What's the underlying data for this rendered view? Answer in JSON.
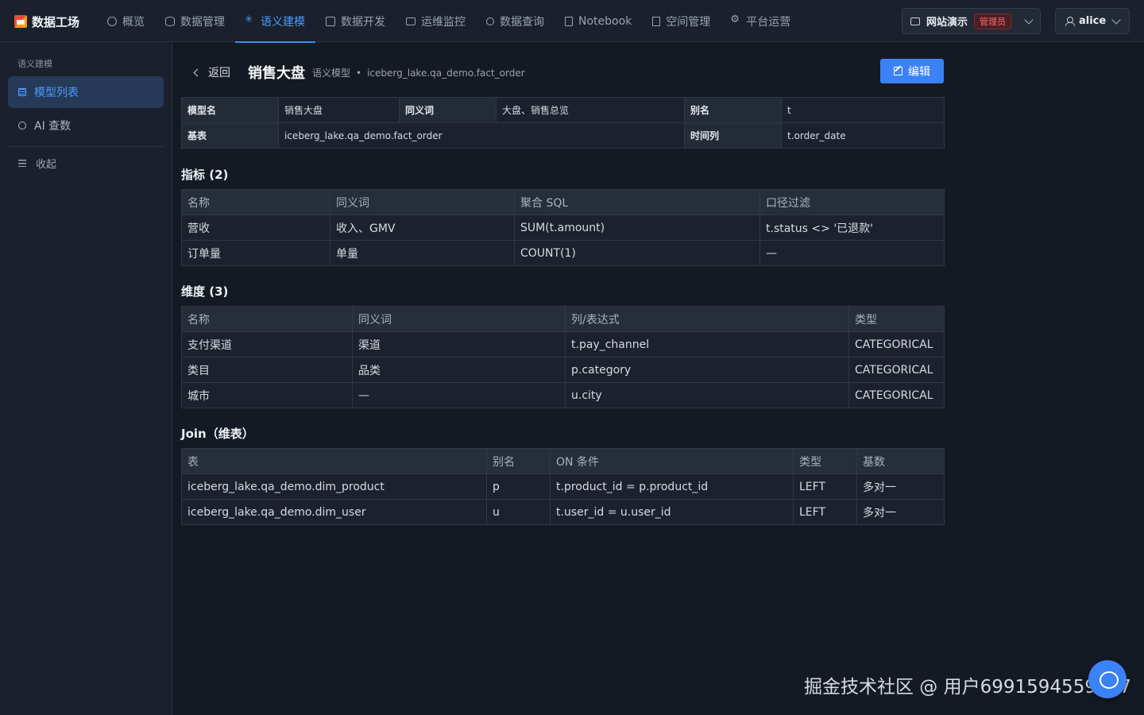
{
  "brand": {
    "name": "数据工场"
  },
  "nav": [
    {
      "label": "概览",
      "icon": "dashboard-icon"
    },
    {
      "label": "数据管理",
      "icon": "database-icon"
    },
    {
      "label": "语义建模",
      "icon": "sparkle-icon",
      "active": true
    },
    {
      "label": "数据开发",
      "icon": "code-icon"
    },
    {
      "label": "运维监控",
      "icon": "monitor-icon"
    },
    {
      "label": "数据查询",
      "icon": "search-icon"
    },
    {
      "label": "Notebook",
      "icon": "notebook-icon"
    },
    {
      "label": "空间管理",
      "icon": "building-icon"
    },
    {
      "label": "平台运营",
      "icon": "gear-icon"
    }
  ],
  "workspace": {
    "name": "网站演示",
    "role": "管理员"
  },
  "user": {
    "name": "alice"
  },
  "sidebar": {
    "title": "语义建模",
    "items": [
      {
        "label": "模型列表",
        "icon": "document-icon",
        "active": true
      },
      {
        "label": "AI 查数",
        "icon": "chat-icon"
      }
    ],
    "collapse_label": "收起"
  },
  "header": {
    "back_label": "返回",
    "title": "销售大盘",
    "sub_type": "语义模型",
    "sub_dot": "•",
    "sub_table": "iceberg_lake.qa_demo.fact_order",
    "edit_label": "编辑"
  },
  "info": {
    "model_name_label": "模型名",
    "model_name": "销售大盘",
    "synonyms_label": "同义词",
    "synonyms": "大盘、销售总览",
    "alias_label": "别名",
    "alias": "t",
    "base_label": "基表",
    "base": "iceberg_lake.qa_demo.fact_order",
    "time_label": "时间列",
    "time": "t.order_date"
  },
  "metrics": {
    "title": "指标 (2)",
    "headers": [
      "名称",
      "同义词",
      "聚合 SQL",
      "口径过滤"
    ],
    "rows": [
      [
        "营收",
        "收入、GMV",
        "SUM(t.amount)",
        "t.status <> '已退款'"
      ],
      [
        "订单量",
        "单量",
        "COUNT(1)",
        "—"
      ]
    ]
  },
  "dimensions": {
    "title": "维度 (3)",
    "headers": [
      "名称",
      "同义词",
      "列/表达式",
      "类型"
    ],
    "rows": [
      [
        "支付渠道",
        "渠道",
        "t.pay_channel",
        "CATEGORICAL"
      ],
      [
        "类目",
        "品类",
        "p.category",
        "CATEGORICAL"
      ],
      [
        "城市",
        "—",
        "u.city",
        "CATEGORICAL"
      ]
    ]
  },
  "joins": {
    "title": "Join（维表）",
    "headers": [
      "表",
      "别名",
      "ON 条件",
      "类型",
      "基数"
    ],
    "rows": [
      [
        "iceberg_lake.qa_demo.dim_product",
        "p",
        "t.product_id = p.product_id",
        "LEFT",
        "多对一"
      ],
      [
        "iceberg_lake.qa_demo.dim_user",
        "u",
        "t.user_id = u.user_id",
        "LEFT",
        "多对一"
      ]
    ]
  },
  "watermark": "掘金技术社区 @ 用户6991594559577"
}
